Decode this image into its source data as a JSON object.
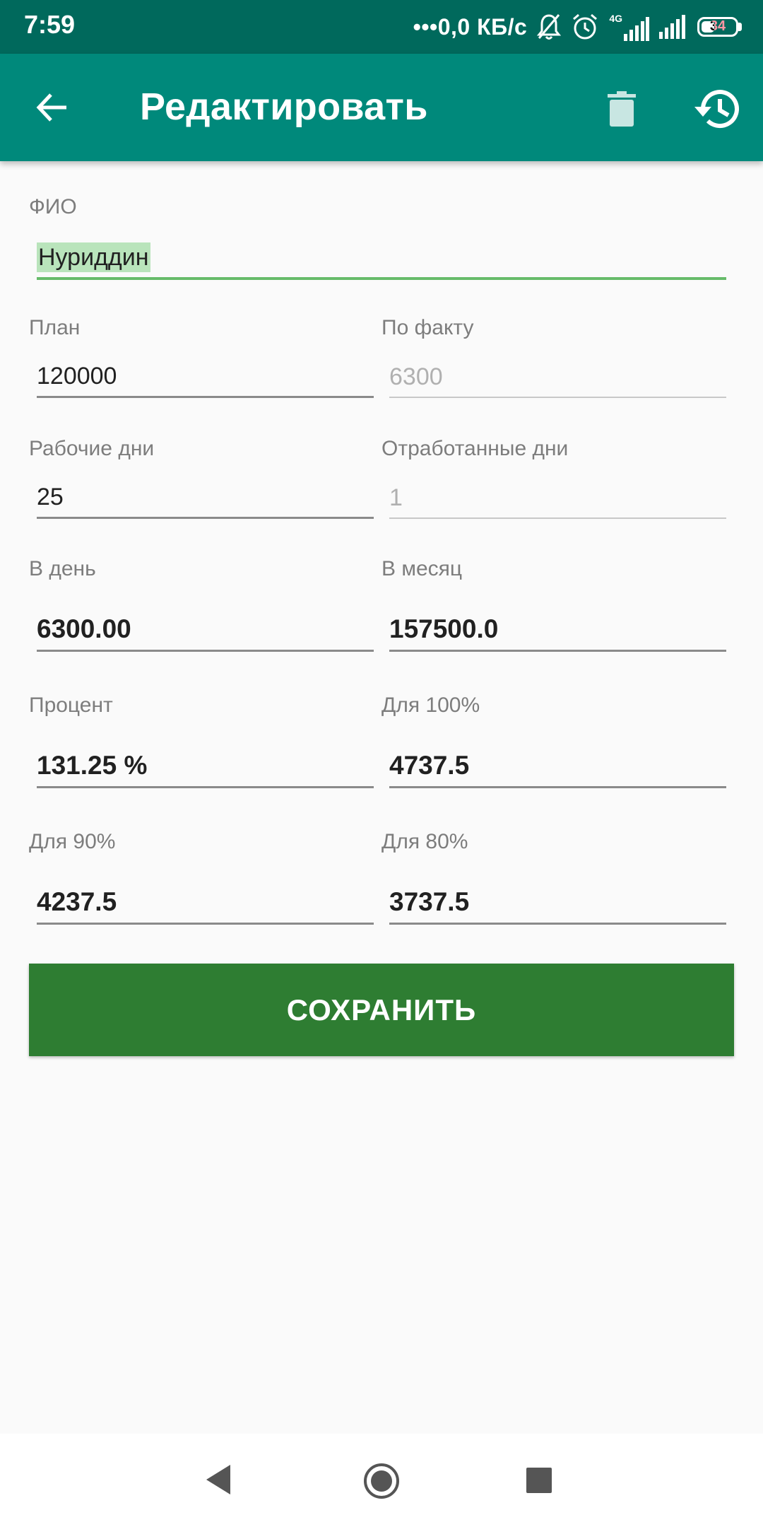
{
  "status_bar": {
    "time": "7:59",
    "network_speed": "•••0,0 КБ/с",
    "network_type": "4G",
    "battery_level": "34",
    "battery_fraction": 0.34
  },
  "app_bar": {
    "title": "Редактировать",
    "back_icon": "arrow-back-icon",
    "delete_icon": "trash-icon",
    "history_icon": "history-icon"
  },
  "form": {
    "fio": {
      "label": "ФИО",
      "value": "Нуриддин"
    },
    "plan": {
      "label": "План",
      "value": "120000"
    },
    "actual": {
      "label": "По факту",
      "value": "6300"
    },
    "work_days": {
      "label": "Рабочие дни",
      "value": "25"
    },
    "worked_days": {
      "label": "Отработанные дни",
      "value": "1"
    },
    "per_day": {
      "label": "В день",
      "value": "6300.00"
    },
    "per_month": {
      "label": "В месяц",
      "value": "157500.0"
    },
    "percent": {
      "label": "Процент",
      "value": "131.25 %"
    },
    "for_100": {
      "label": "Для 100%",
      "value": "4737.5"
    },
    "for_90": {
      "label": "Для 90%",
      "value": "4237.5"
    },
    "for_80": {
      "label": "Для 80%",
      "value": "3737.5"
    }
  },
  "save_button": {
    "label": "СОХРАНИТЬ"
  },
  "colors": {
    "status_bar": "#00695c",
    "app_bar": "#00897b",
    "save_button": "#2e7d32",
    "focus_underline": "#66bb6a",
    "selection": "#b9e4bb"
  }
}
